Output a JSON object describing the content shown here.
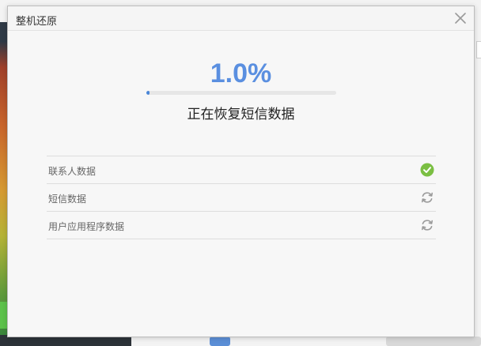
{
  "dialog": {
    "title": "整机还原",
    "close_icon": "close-icon"
  },
  "progress": {
    "percent_text": "1.0%",
    "fraction": 0.01,
    "status_text": "正在恢复短信数据",
    "accent_color": "#5a8fe0"
  },
  "items": [
    {
      "label": "联系人数据",
      "state": "done",
      "icon": "check-circle-icon"
    },
    {
      "label": "短信数据",
      "state": "pending",
      "icon": "refresh-icon"
    },
    {
      "label": "用户应用程序数据",
      "state": "pending",
      "icon": "refresh-icon"
    }
  ],
  "colors": {
    "done": "#7bbf43",
    "pending": "#9a9a9a"
  }
}
